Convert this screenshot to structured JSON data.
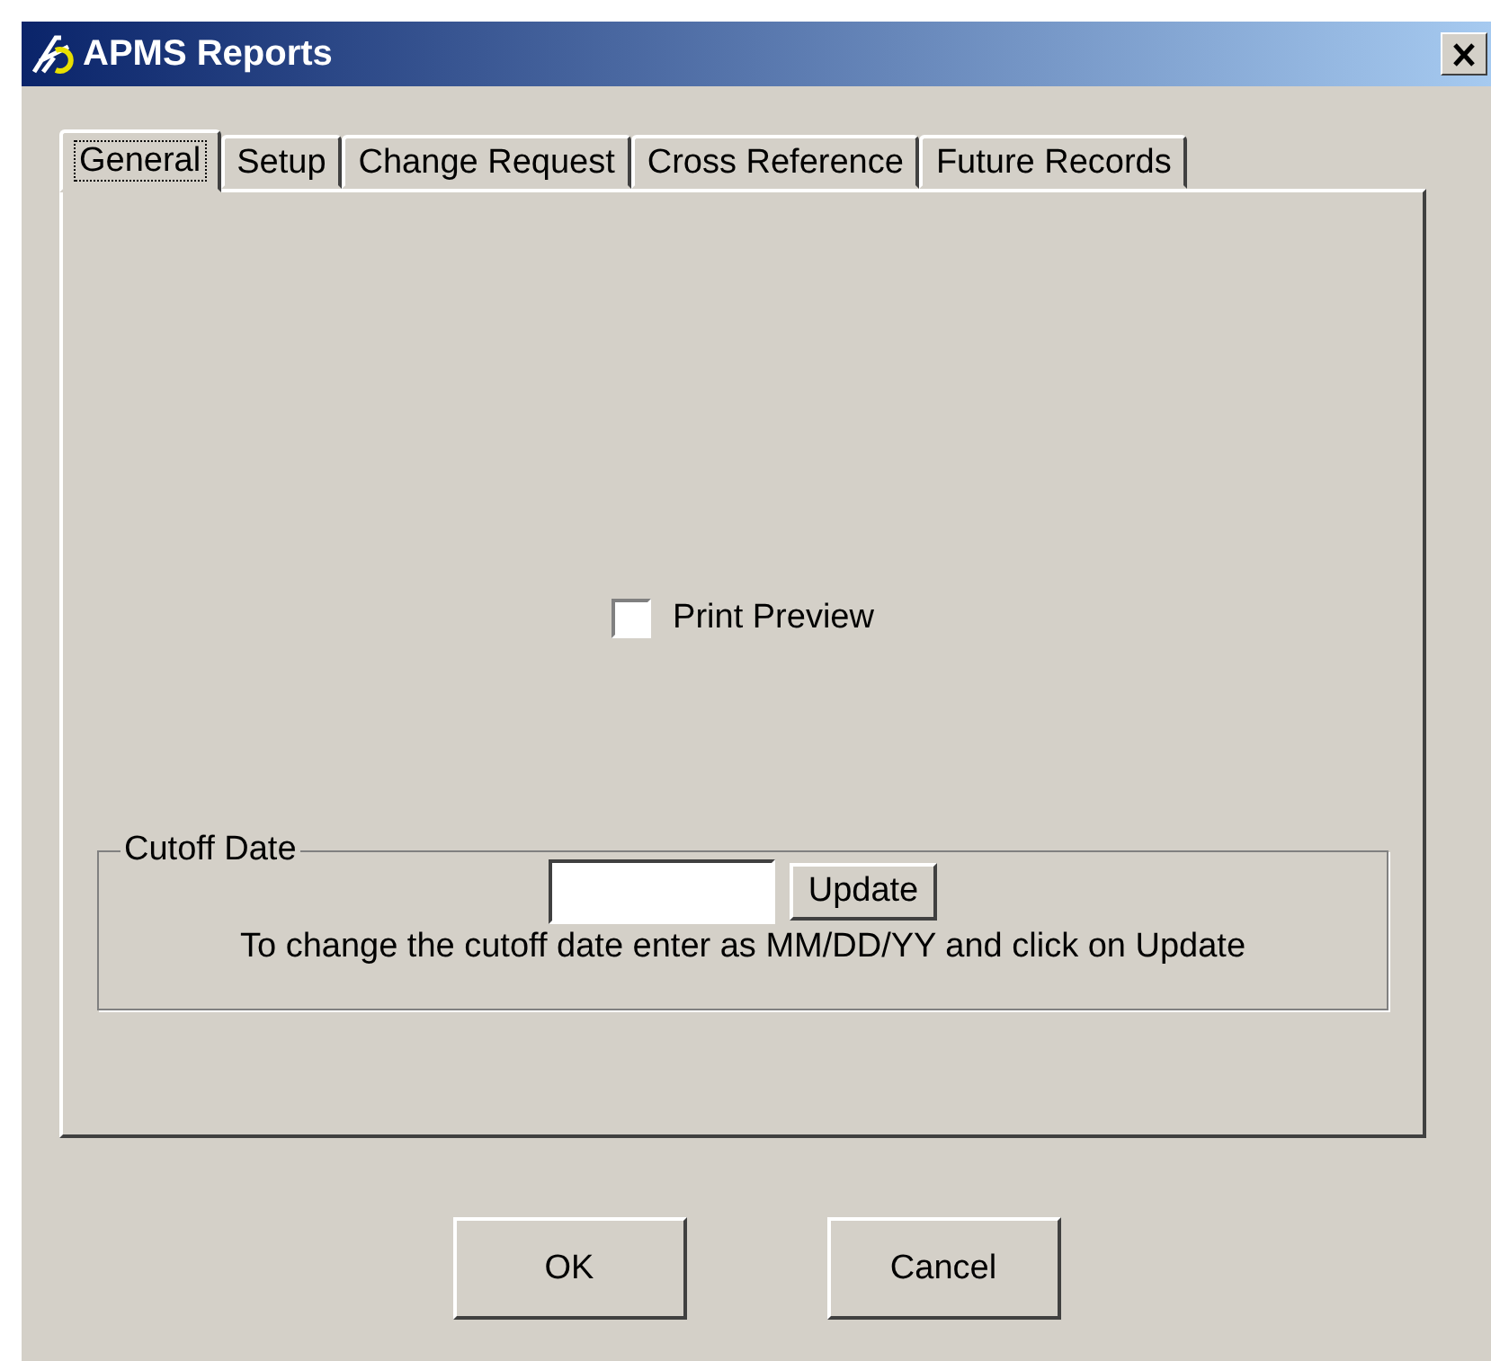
{
  "window": {
    "title": "APMS Reports"
  },
  "tabs": [
    {
      "label": "General",
      "selected": true
    },
    {
      "label": "Setup",
      "selected": false
    },
    {
      "label": "Change Request",
      "selected": false
    },
    {
      "label": "Cross Reference",
      "selected": false
    },
    {
      "label": "Future Records",
      "selected": false
    }
  ],
  "print_preview": {
    "label": "Print Preview",
    "checked": false
  },
  "cutoff_date": {
    "title": "Cutoff Date",
    "button": "Update",
    "hint": "To change the cutoff date enter as MM/DD/YY and click on Update"
  },
  "buttons": [
    "OK",
    "Cancel"
  ]
}
